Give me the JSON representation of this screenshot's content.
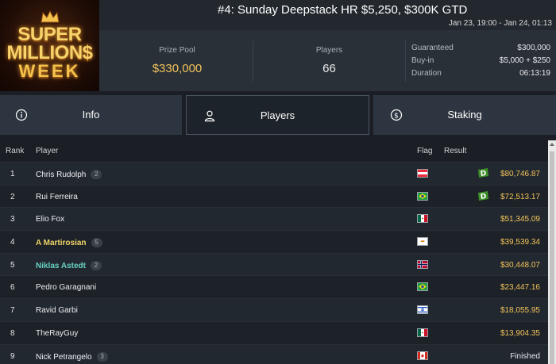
{
  "header": {
    "title": "#4: Sunday Deepstack HR $5,250, $300K GTD",
    "dates": "Jan 23, 19:00 - Jan 24, 01:13"
  },
  "logo": {
    "line1": "SUPER",
    "line2": "MILLION$",
    "line3": "WEEK"
  },
  "stats": {
    "prize_pool_label": "Prize Pool",
    "prize_pool_value": "$330,000",
    "players_label": "Players",
    "players_value": "66",
    "details": [
      {
        "label": "Guaranteed",
        "value": "$300,000"
      },
      {
        "label": "Buy-in",
        "value": "$5,000 + $250"
      },
      {
        "label": "Duration",
        "value": "06:13:19"
      }
    ]
  },
  "tabs": [
    {
      "label": "Info",
      "icon": "info-circle-icon"
    },
    {
      "label": "Players",
      "icon": "user-icon",
      "active": true
    },
    {
      "label": "Staking",
      "icon": "dollar-circle-icon"
    }
  ],
  "table": {
    "headers": {
      "rank": "Rank",
      "player": "Player",
      "flag": "Flag",
      "result": "Result"
    },
    "rows": [
      {
        "rank": "1",
        "player": "Chris Rudolph",
        "badge": "2",
        "style": "normal",
        "flag": "austria",
        "result": "$80,746.87",
        "staked": true
      },
      {
        "rank": "2",
        "player": "Rui Ferreira",
        "badge": "",
        "style": "normal",
        "flag": "brazil",
        "result": "$72,513.17",
        "staked": true
      },
      {
        "rank": "3",
        "player": "Elio Fox",
        "badge": "",
        "style": "normal",
        "flag": "mexico",
        "result": "$51,345.09",
        "staked": false
      },
      {
        "rank": "4",
        "player": "A Martirosian",
        "badge": "5",
        "style": "gold",
        "flag": "cyprus",
        "result": "$39,539.34",
        "staked": false
      },
      {
        "rank": "5",
        "player": "Niklas Astedt",
        "badge": "2",
        "style": "teal",
        "flag": "norway",
        "result": "$30,448.07",
        "staked": false
      },
      {
        "rank": "6",
        "player": "Pedro Garagnani",
        "badge": "",
        "style": "normal",
        "flag": "brazil",
        "result": "$23,447.16",
        "staked": false
      },
      {
        "rank": "7",
        "player": "Ravid Garbi",
        "badge": "",
        "style": "normal",
        "flag": "israel",
        "result": "$18,055.95",
        "staked": false
      },
      {
        "rank": "8",
        "player": "TheRayGuy",
        "badge": "",
        "style": "normal",
        "flag": "mexico",
        "result": "$13,904.35",
        "staked": false
      },
      {
        "rank": "9",
        "player": "Nick Petrangelo",
        "badge": "3",
        "style": "normal",
        "flag": "canada",
        "result": "Finished",
        "staked": false
      }
    ]
  },
  "colors": {
    "accent_gold": "#f2c35a",
    "teal": "#67d2c3",
    "stake_green": "#3f8f2a"
  }
}
